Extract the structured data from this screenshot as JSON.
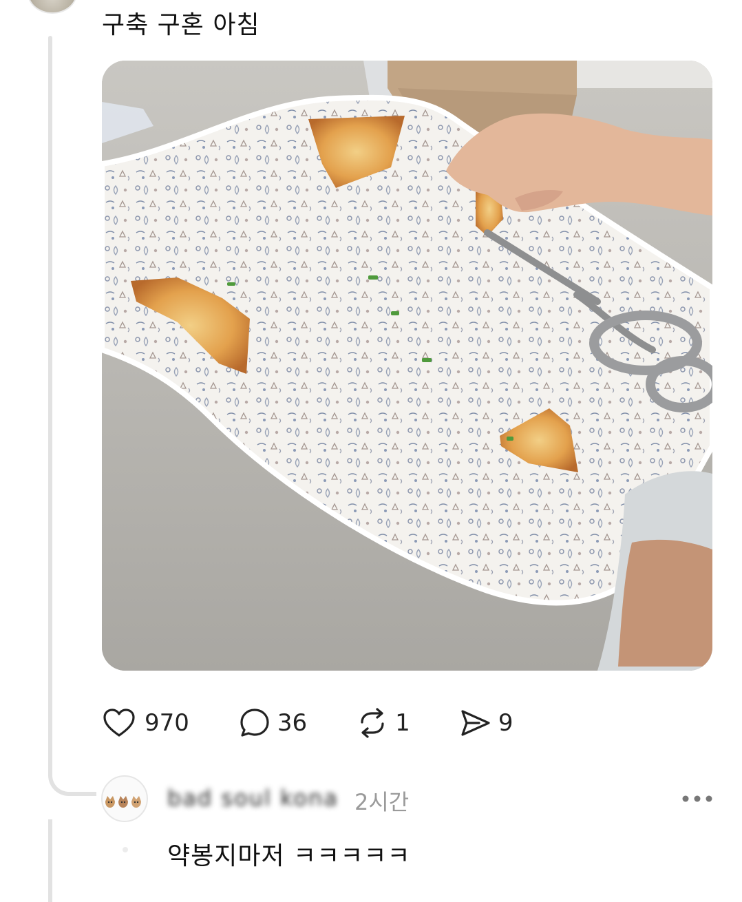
{
  "post": {
    "text": "구축 구혼 아침",
    "image_alt": "tray with leftover pancake pieces and scissors",
    "actions": {
      "likes": "970",
      "comments": "36",
      "reposts": "1",
      "shares": "9"
    }
  },
  "reply": {
    "username": "bad soul kona",
    "time": "2시간",
    "text": "약봉지마저 ㅋㅋㅋㅋㅋ",
    "more_label": "..."
  },
  "icons": {
    "like": "heart-icon",
    "comment": "speech-bubble-icon",
    "repost": "repost-icon",
    "share": "send-icon",
    "more": "more-dots-icon"
  },
  "colors": {
    "text": "#111111",
    "muted": "#9a9a9a",
    "thread": "#e2e2e2"
  }
}
